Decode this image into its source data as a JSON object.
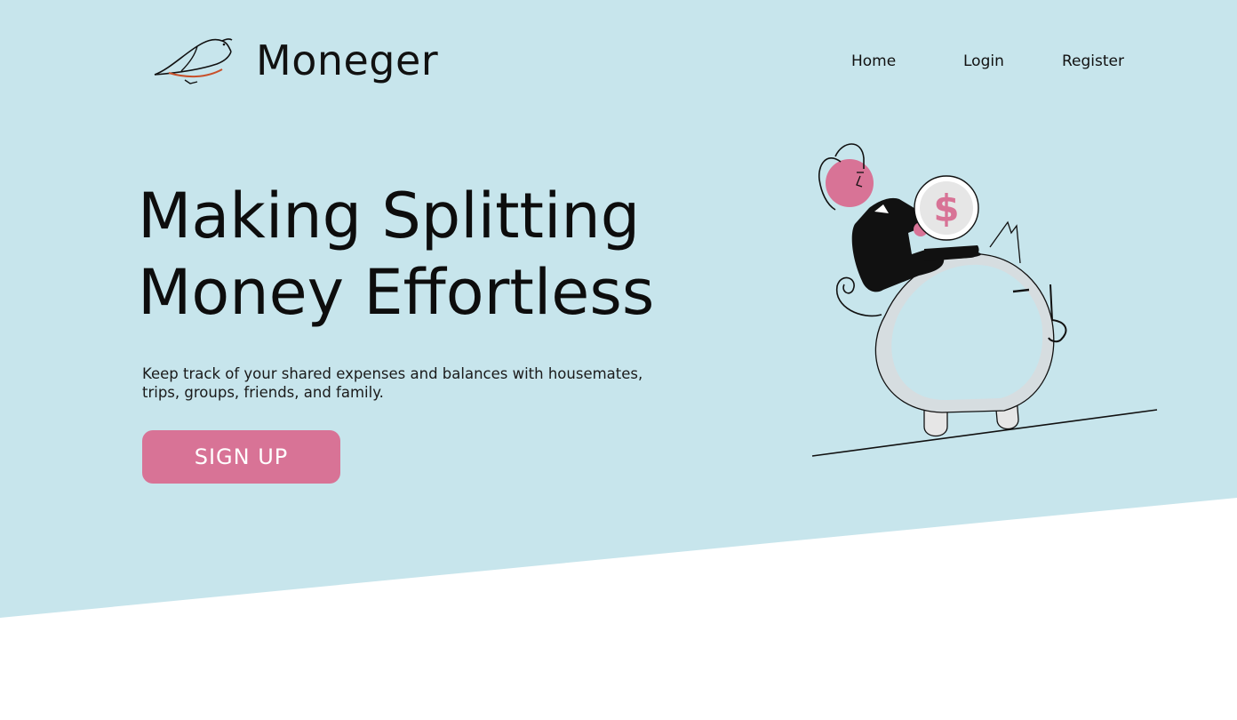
{
  "brand": {
    "name": "Moneger",
    "logo_icon": "bird-logo-icon"
  },
  "nav": {
    "items": [
      {
        "label": "Home"
      },
      {
        "label": "Login"
      },
      {
        "label": "Register"
      }
    ]
  },
  "hero": {
    "headline_line1": "Making Splitting",
    "headline_line2": "Money Effortless",
    "subtext_line1": "Keep track of your shared expenses and balances with housemates,",
    "subtext_line2": "trips, groups, friends, and family.",
    "cta_label": "SIGN UP",
    "illustration": "piggy-bank-illustration",
    "coin_symbol": "$"
  },
  "colors": {
    "hero_background": "#c7e5ec",
    "accent_pink": "#d87396",
    "page_background": "#ffffff",
    "text": "#111111",
    "logo_accent": "#c8502a"
  }
}
